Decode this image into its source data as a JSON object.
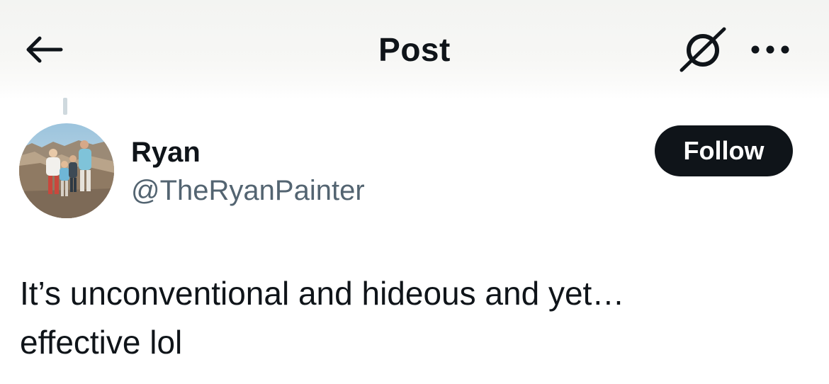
{
  "header": {
    "back_icon": "arrow-left-icon",
    "title": "Post",
    "grok_icon": "grok-icon",
    "more_icon": "more-horizontal-icon"
  },
  "author": {
    "display_name": "Ryan",
    "handle": "@TheRyanPainter",
    "avatar": "family-photo-avatar",
    "follow_label": "Follow"
  },
  "post": {
    "text_line_1": "It’s unconventional and hideous and yet…",
    "text_line_2": "effective lol"
  },
  "colors": {
    "text_primary": "#0f1419",
    "text_secondary": "#536471",
    "follow_bg": "#0f1419",
    "follow_text": "#ffffff",
    "thread_line": "#cfd9de"
  }
}
